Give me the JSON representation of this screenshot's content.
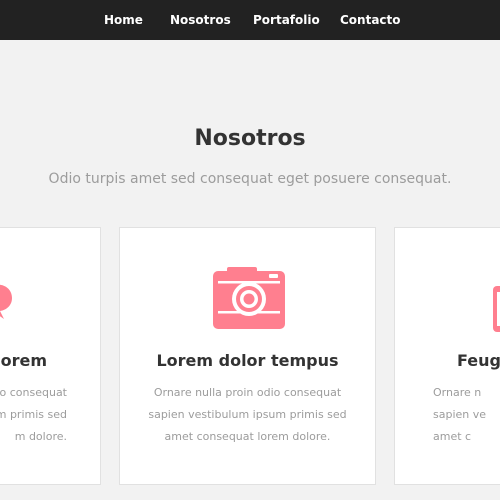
{
  "nav": {
    "items": [
      {
        "label": "Home"
      },
      {
        "label": "Nosotros"
      },
      {
        "label": "Portafolio"
      },
      {
        "label": "Contacto"
      }
    ]
  },
  "section": {
    "title": "Nosotros",
    "subtitle": "Odio turpis amet sed consequat eget posuere consequat."
  },
  "cards": [
    {
      "icon": "speech-bubble-icon",
      "title": "orem",
      "lines": [
        "o consequat",
        "m primis sed",
        "m dolore."
      ]
    },
    {
      "icon": "camera-icon",
      "title": "Lorem dolor tempus",
      "lines": [
        "Ornare nulla proin odio consequat",
        "sapien vestibulum ipsum primis sed",
        "amet consequat lorem dolore."
      ]
    },
    {
      "icon": "phone-icon",
      "title": "Feugi",
      "lines": [
        "Ornare n",
        "sapien ve",
        "amet c"
      ]
    }
  ],
  "colors": {
    "accent": "#ff7f8f",
    "navbar": "#222222",
    "background": "#f2f2f2",
    "heading": "#333333",
    "muted": "#9c9c9c"
  }
}
